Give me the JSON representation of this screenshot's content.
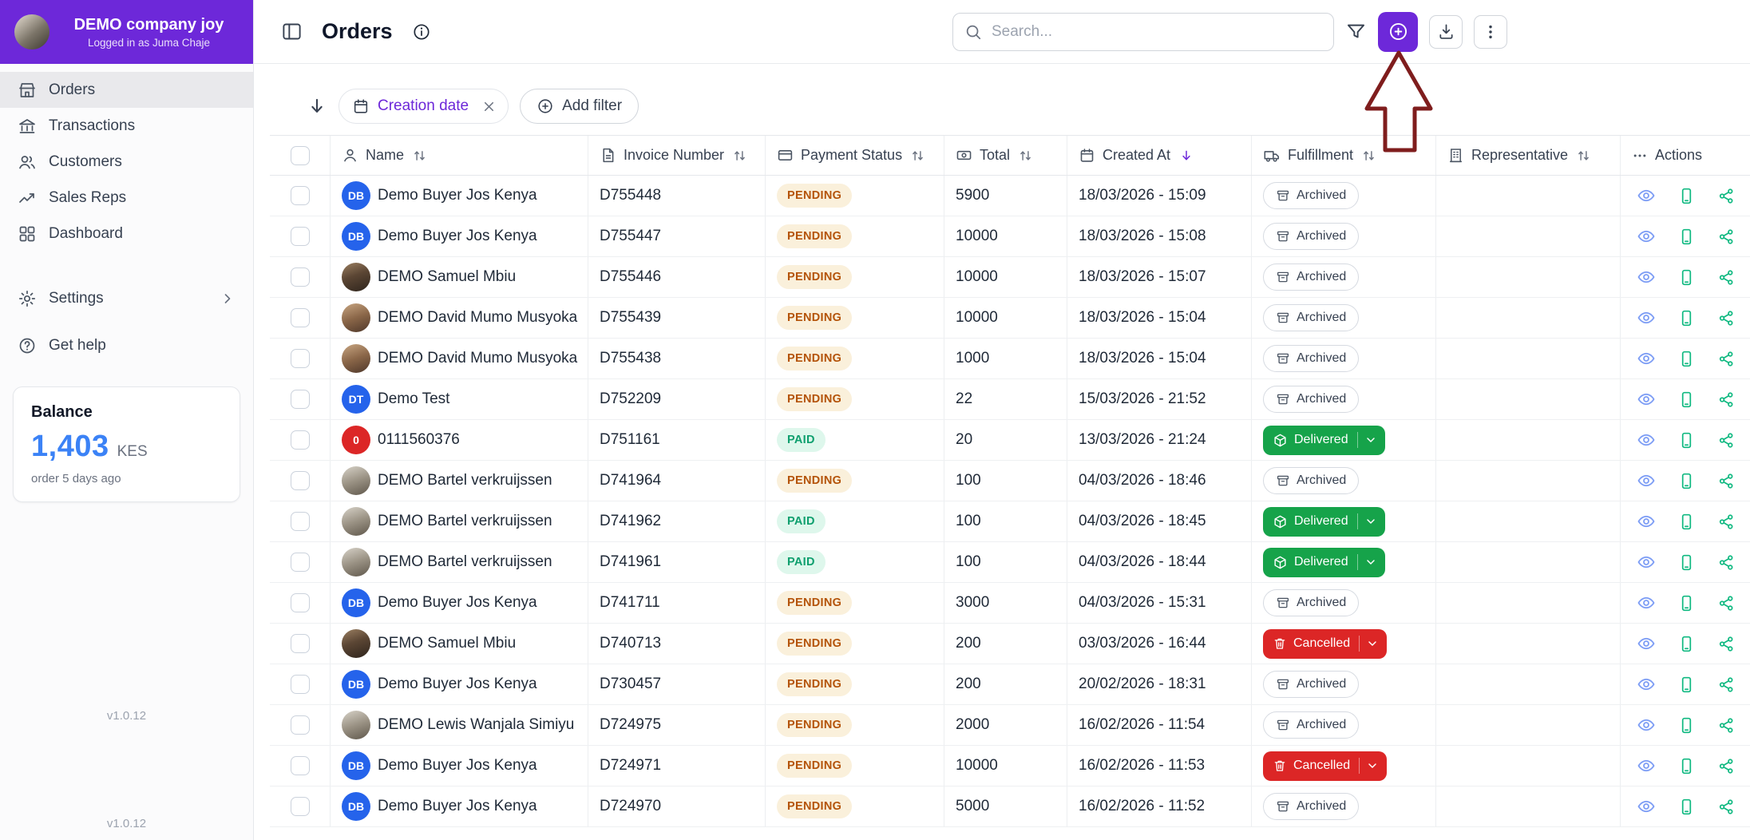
{
  "sidebar": {
    "company": "DEMO company joy",
    "logged_in": "Logged in as Juma Chaje",
    "nav": [
      {
        "label": "Orders"
      },
      {
        "label": "Transactions"
      },
      {
        "label": "Customers"
      },
      {
        "label": "Sales Reps"
      },
      {
        "label": "Dashboard"
      }
    ],
    "settings": "Settings",
    "get_help": "Get help",
    "balance": {
      "title": "Balance",
      "amount": "1,403",
      "currency": "KES",
      "note": "order 5 days ago"
    },
    "version": "v1.0.12"
  },
  "topbar": {
    "title": "Orders",
    "search_placeholder": "Search..."
  },
  "filterbar": {
    "chip_label": "Creation date",
    "add_filter_label": "Add filter"
  },
  "table": {
    "columns": [
      "Name",
      "Invoice Number",
      "Payment Status",
      "Total",
      "Created At",
      "Fulfillment",
      "Representative",
      "Actions"
    ],
    "rows": [
      {
        "avatar": {
          "type": "initials",
          "text": "DB",
          "bg": "#2563eb"
        },
        "name": "Demo Buyer Jos Kenya",
        "invoice": "D755448",
        "payment": {
          "type": "pending",
          "label": "PENDING"
        },
        "total": "5900",
        "created": "18/03/2026 - 15:09",
        "fulfillment": {
          "status": "archived",
          "label": "Archived"
        },
        "representative": ""
      },
      {
        "avatar": {
          "type": "initials",
          "text": "DB",
          "bg": "#2563eb"
        },
        "name": "Demo Buyer Jos Kenya",
        "invoice": "D755447",
        "payment": {
          "type": "pending",
          "label": "PENDING"
        },
        "total": "10000",
        "created": "18/03/2026 - 15:08",
        "fulfillment": {
          "status": "archived",
          "label": "Archived"
        },
        "representative": ""
      },
      {
        "avatar": {
          "type": "photo",
          "variant": "dark"
        },
        "name": "DEMO Samuel Mbiu",
        "invoice": "D755446",
        "payment": {
          "type": "pending",
          "label": "PENDING"
        },
        "total": "10000",
        "created": "18/03/2026 - 15:07",
        "fulfillment": {
          "status": "archived",
          "label": "Archived"
        },
        "representative": ""
      },
      {
        "avatar": {
          "type": "photo",
          "variant": "tan"
        },
        "name": "DEMO David Mumo Musyoka",
        "invoice": "D755439",
        "payment": {
          "type": "pending",
          "label": "PENDING"
        },
        "total": "10000",
        "created": "18/03/2026 - 15:04",
        "fulfillment": {
          "status": "archived",
          "label": "Archived"
        },
        "representative": ""
      },
      {
        "avatar": {
          "type": "photo",
          "variant": "tan"
        },
        "name": "DEMO David Mumo Musyoka",
        "invoice": "D755438",
        "payment": {
          "type": "pending",
          "label": "PENDING"
        },
        "total": "1000",
        "created": "18/03/2026 - 15:04",
        "fulfillment": {
          "status": "archived",
          "label": "Archived"
        },
        "representative": ""
      },
      {
        "avatar": {
          "type": "initials",
          "text": "DT",
          "bg": "#2563eb"
        },
        "name": "Demo Test",
        "invoice": "D752209",
        "payment": {
          "type": "pending",
          "label": "PENDING"
        },
        "total": "22",
        "created": "15/03/2026 - 21:52",
        "fulfillment": {
          "status": "archived",
          "label": "Archived"
        },
        "representative": ""
      },
      {
        "avatar": {
          "type": "initials",
          "text": "0",
          "bg": "#dc2626"
        },
        "name": "0111560376",
        "invoice": "D751161",
        "payment": {
          "type": "paid",
          "label": "PAID"
        },
        "total": "20",
        "created": "13/03/2026 - 21:24",
        "fulfillment": {
          "status": "delivered",
          "label": "Delivered"
        },
        "representative": ""
      },
      {
        "avatar": {
          "type": "photo",
          "variant": "light"
        },
        "name": "DEMO Bartel verkruijssen",
        "invoice": "D741964",
        "payment": {
          "type": "pending",
          "label": "PENDING"
        },
        "total": "100",
        "created": "04/03/2026 - 18:46",
        "fulfillment": {
          "status": "archived",
          "label": "Archived"
        },
        "representative": ""
      },
      {
        "avatar": {
          "type": "photo",
          "variant": "light"
        },
        "name": "DEMO Bartel verkruijssen",
        "invoice": "D741962",
        "payment": {
          "type": "paid",
          "label": "PAID"
        },
        "total": "100",
        "created": "04/03/2026 - 18:45",
        "fulfillment": {
          "status": "delivered",
          "label": "Delivered"
        },
        "representative": ""
      },
      {
        "avatar": {
          "type": "photo",
          "variant": "light"
        },
        "name": "DEMO Bartel verkruijssen",
        "invoice": "D741961",
        "payment": {
          "type": "paid",
          "label": "PAID"
        },
        "total": "100",
        "created": "04/03/2026 - 18:44",
        "fulfillment": {
          "status": "delivered",
          "label": "Delivered"
        },
        "representative": ""
      },
      {
        "avatar": {
          "type": "initials",
          "text": "DB",
          "bg": "#2563eb"
        },
        "name": "Demo Buyer Jos Kenya",
        "invoice": "D741711",
        "payment": {
          "type": "pending",
          "label": "PENDING"
        },
        "total": "3000",
        "created": "04/03/2026 - 15:31",
        "fulfillment": {
          "status": "archived",
          "label": "Archived"
        },
        "representative": ""
      },
      {
        "avatar": {
          "type": "photo",
          "variant": "dark"
        },
        "name": "DEMO Samuel Mbiu",
        "invoice": "D740713",
        "payment": {
          "type": "pending",
          "label": "PENDING"
        },
        "total": "200",
        "created": "03/03/2026 - 16:44",
        "fulfillment": {
          "status": "cancelled",
          "label": "Cancelled"
        },
        "representative": ""
      },
      {
        "avatar": {
          "type": "initials",
          "text": "DB",
          "bg": "#2563eb"
        },
        "name": "Demo Buyer Jos Kenya",
        "invoice": "D730457",
        "payment": {
          "type": "pending",
          "label": "PENDING"
        },
        "total": "200",
        "created": "20/02/2026 - 18:31",
        "fulfillment": {
          "status": "archived",
          "label": "Archived"
        },
        "representative": ""
      },
      {
        "avatar": {
          "type": "photo",
          "variant": "light"
        },
        "name": "DEMO Lewis Wanjala Simiyu",
        "invoice": "D724975",
        "payment": {
          "type": "pending",
          "label": "PENDING"
        },
        "total": "2000",
        "created": "16/02/2026 - 11:54",
        "fulfillment": {
          "status": "archived",
          "label": "Archived"
        },
        "representative": ""
      },
      {
        "avatar": {
          "type": "initials",
          "text": "DB",
          "bg": "#2563eb"
        },
        "name": "Demo Buyer Jos Kenya",
        "invoice": "D724971",
        "payment": {
          "type": "pending",
          "label": "PENDING"
        },
        "total": "10000",
        "created": "16/02/2026 - 11:53",
        "fulfillment": {
          "status": "cancelled",
          "label": "Cancelled"
        },
        "representative": ""
      },
      {
        "avatar": {
          "type": "initials",
          "text": "DB",
          "bg": "#2563eb"
        },
        "name": "Demo Buyer Jos Kenya",
        "invoice": "D724970",
        "payment": {
          "type": "pending",
          "label": "PENDING"
        },
        "total": "5000",
        "created": "16/02/2026 - 11:52",
        "fulfillment": {
          "status": "archived",
          "label": "Archived"
        },
        "representative": ""
      }
    ]
  },
  "colors": {
    "brand_purple": "#6d28d9",
    "balance_blue": "#3b82f6",
    "pending_bg": "#faf0db",
    "pending_text": "#b45309",
    "paid_bg": "#def7ec",
    "paid_text": "#0e9f6e",
    "delivered_green": "#16a34a",
    "cancelled_red": "#dc2626",
    "action_blue": "#7d9df5",
    "action_green": "#10b981",
    "annotation_red": "#7f1d1d"
  }
}
